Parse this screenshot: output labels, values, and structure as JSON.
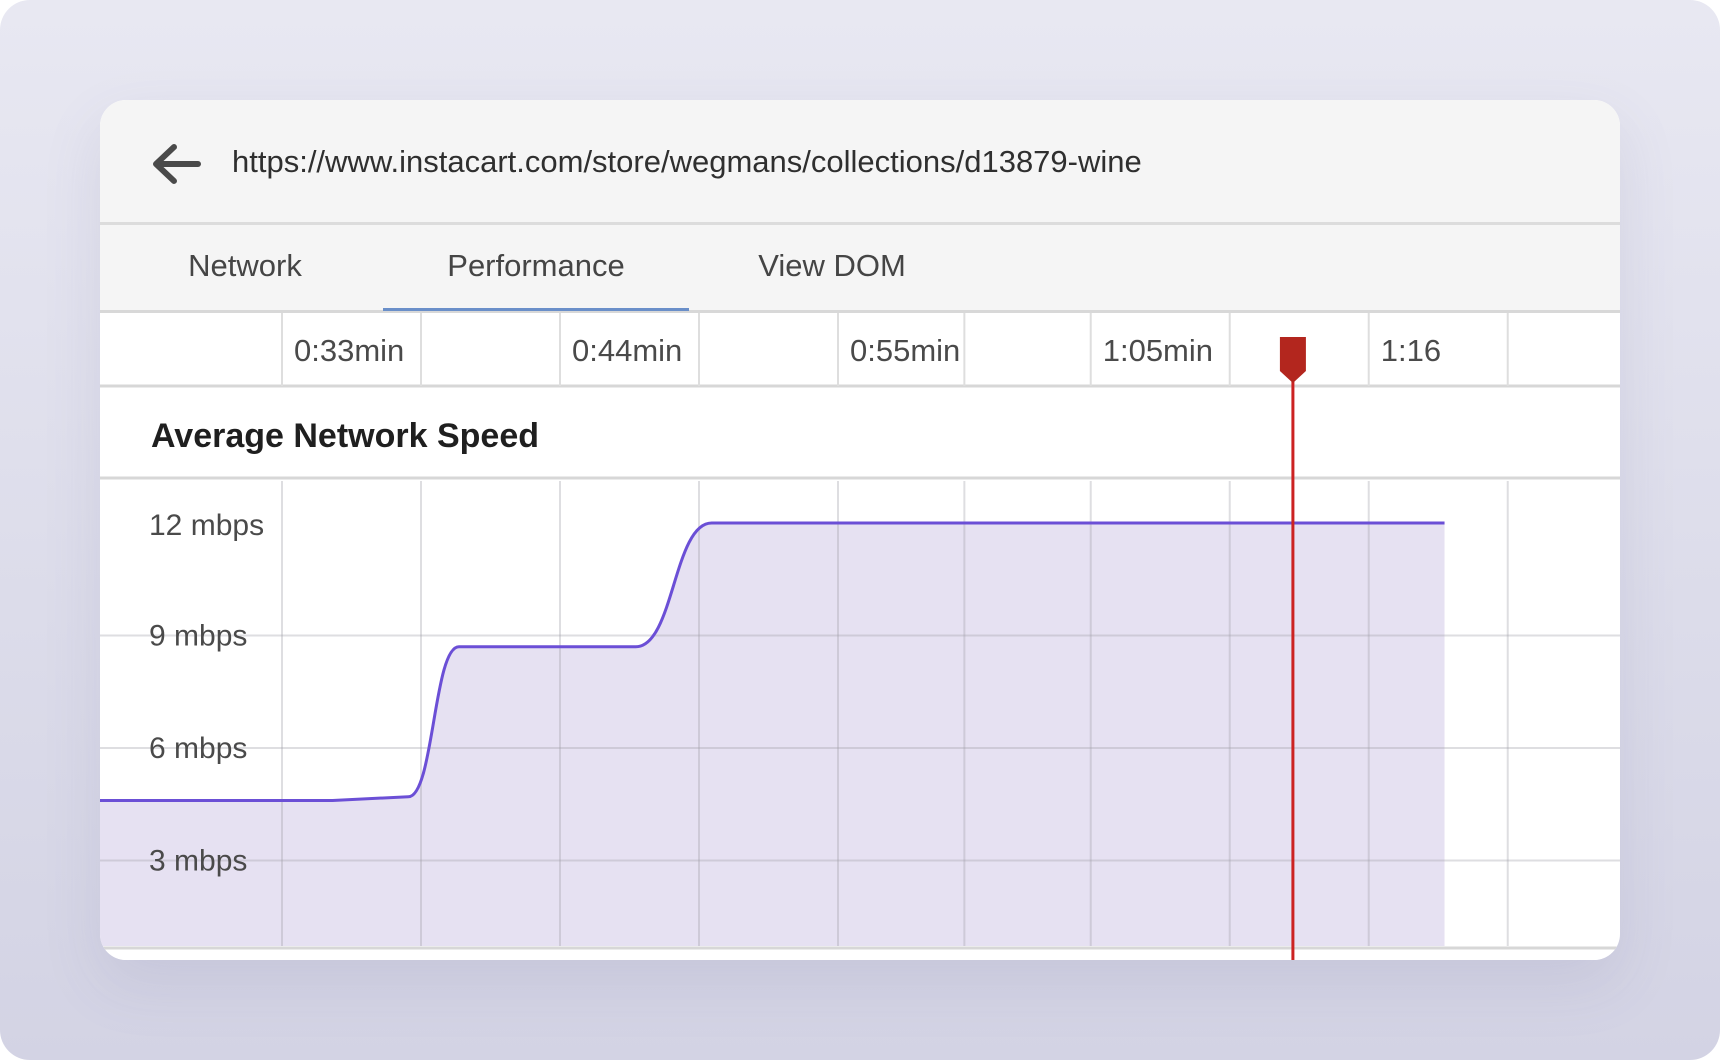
{
  "browser": {
    "url": "https://www.instacart.com/store/wegmans/collections/d13879-wine",
    "back_icon": "arrow-left-icon"
  },
  "tabs": [
    {
      "label": "Network",
      "active": false
    },
    {
      "label": "Performance",
      "active": true
    },
    {
      "label": "View DOM",
      "active": false
    }
  ],
  "timeline": {
    "ticks": [
      "0:33min",
      "0:44min",
      "0:55min",
      "1:05min",
      "1:16"
    ],
    "marker_icon": "playhead-marker-icon"
  },
  "colors": {
    "accent_tab": "#6a8fc9",
    "series_line": "#6b4fd6",
    "series_fill": "#e6e1f2",
    "playhead": "#cc2222",
    "playhead_head": "#b3261e"
  },
  "chart_data": {
    "type": "area",
    "title": "Average Network Speed",
    "y_ticks": [
      "12 mbps",
      "9 mbps",
      "6 mbps",
      "3 mbps"
    ],
    "ylim": [
      0,
      12.5
    ],
    "unit": "mbps",
    "series": [
      {
        "x": [
          "0:25min",
          "0:35min",
          "0:38min",
          "0:40min",
          "0:47min",
          "0:50min",
          "1:00min",
          "1:15min",
          "1:19min"
        ],
        "values": [
          4.6,
          4.6,
          4.7,
          8.7,
          8.7,
          12.0,
          12.0,
          12.0,
          12.0
        ]
      }
    ],
    "playhead_time": "1:13min"
  }
}
